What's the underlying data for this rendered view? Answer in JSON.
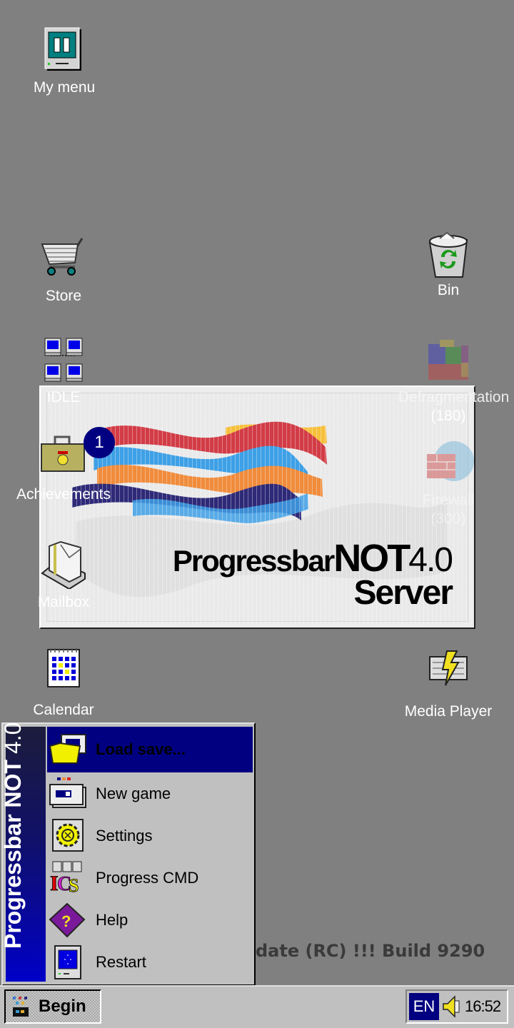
{
  "desktop": {
    "background_color": "#808080",
    "icons": [
      {
        "label": "My menu",
        "icon": "computer-pause-icon"
      },
      {
        "label": "Store",
        "icon": "shopping-cart-icon"
      },
      {
        "label": "Bin",
        "icon": "recycle-bin-icon"
      },
      {
        "label": "IDLE",
        "icon": "network-computers-icon"
      },
      {
        "label": "Defragmentation",
        "sublabel": "(180)",
        "icon": "defrag-blocks-icon",
        "disabled": true
      },
      {
        "label": "Achievements",
        "icon": "achievements-case-icon",
        "badge": "1"
      },
      {
        "label": "Firewall",
        "sublabel": "(300)",
        "icon": "firewall-globe-icon",
        "disabled": true
      },
      {
        "label": "Mailbox",
        "icon": "mailbox-icon"
      },
      {
        "label": "Calendar",
        "icon": "calendar-icon"
      },
      {
        "label": "Media Player",
        "icon": "media-player-icon"
      }
    ]
  },
  "splash": {
    "brand_word": "Progressbar",
    "brand_not": "NOT",
    "brand_version": "4.0",
    "brand_edition": "Server",
    "colors": {
      "red": "#d23c46",
      "blue": "#3ea0e6",
      "orange": "#f08c3c",
      "navy": "#2e2a78",
      "yellow": "#f6c03c"
    }
  },
  "start_menu": {
    "banner_bold": "Progressbar NOT",
    "banner_version": "4.0",
    "items": [
      {
        "label": "Load save...",
        "icon": "folder-open-icon",
        "active": true
      },
      {
        "label": "New game",
        "icon": "new-game-window-icon"
      },
      {
        "label": "Settings",
        "icon": "gear-icon"
      },
      {
        "label": "Progress CMD",
        "icon": "cmd-icon"
      },
      {
        "label": "Help",
        "icon": "help-book-icon"
      },
      {
        "label": "Restart",
        "icon": "restart-computer-icon"
      }
    ]
  },
  "build_text": "date (RC) !!! Build 9290",
  "taskbar": {
    "begin_label": "Begin",
    "language": "EN",
    "clock": "16:52"
  }
}
